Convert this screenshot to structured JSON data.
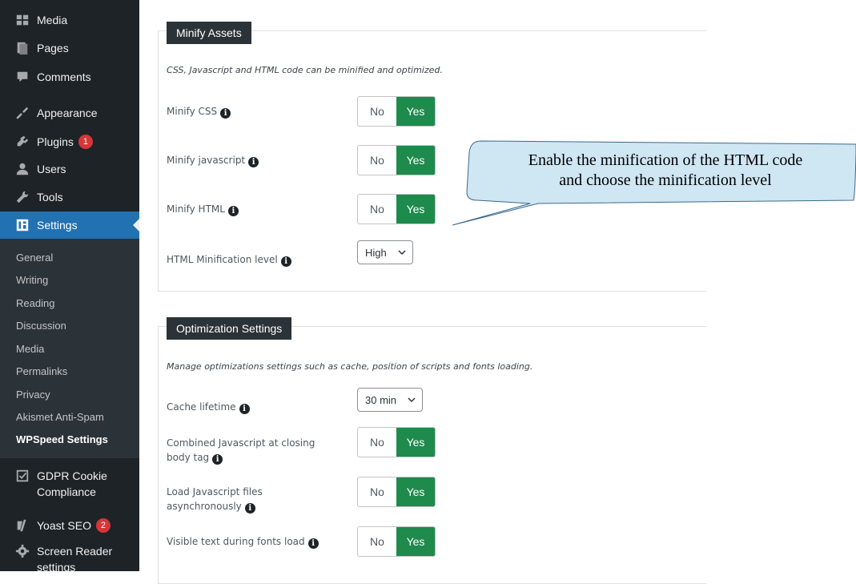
{
  "sidebar": {
    "menu": [
      {
        "label": "Media",
        "icon": "media-icon"
      },
      {
        "label": "Pages",
        "icon": "pages-icon"
      },
      {
        "label": "Comments",
        "icon": "comments-icon"
      },
      {
        "label": "Appearance",
        "icon": "appearance-icon"
      },
      {
        "label": "Plugins",
        "icon": "plugins-icon",
        "badge": "1"
      },
      {
        "label": "Users",
        "icon": "users-icon"
      },
      {
        "label": "Tools",
        "icon": "tools-icon"
      },
      {
        "label": "Settings",
        "icon": "settings-icon"
      }
    ],
    "submenu": [
      "General",
      "Writing",
      "Reading",
      "Discussion",
      "Media",
      "Permalinks",
      "Privacy",
      "Akismet Anti-Spam",
      "WPSpeed Settings"
    ],
    "bottom_menu": [
      {
        "label_line1": "GDPR Cookie",
        "label_line2": "Compliance",
        "icon": "checkbox-icon"
      },
      {
        "label": "Yoast SEO",
        "icon": "yoast-icon",
        "badge": "2"
      },
      {
        "label_line1": "Screen Reader",
        "label_line2": "settings",
        "icon": "gear-icon"
      }
    ]
  },
  "minify_panel": {
    "title": "Minify Assets",
    "description": "CSS, Javascript and HTML code can be minified and optimized.",
    "rows": [
      {
        "label": "Minify CSS",
        "no": "No",
        "yes": "Yes"
      },
      {
        "label": "Minify javascript",
        "no": "No",
        "yes": "Yes"
      },
      {
        "label": "Minify HTML",
        "no": "No",
        "yes": "Yes"
      }
    ],
    "level": {
      "label": "HTML Minification level",
      "value": "High"
    }
  },
  "optimization_panel": {
    "title": "Optimization Settings",
    "description": "Manage optimizations settings such as cache, position of scripts and fonts loading.",
    "cache": {
      "label": "Cache lifetime",
      "value": "30 min"
    },
    "rows": [
      {
        "label_line1": "Combined Javascript at closing",
        "label_line2": "body tag",
        "no": "No",
        "yes": "Yes"
      },
      {
        "label_line1": "Load Javascript files",
        "label_line2": "asynchronously",
        "no": "No",
        "yes": "Yes"
      },
      {
        "label": "Visible text during fonts load",
        "no": "No",
        "yes": "Yes"
      }
    ]
  },
  "callout": {
    "line1": "Enable the minification of the HTML code",
    "line2": "and choose the minification level"
  },
  "colors": {
    "sidebar_bg": "#1d2327",
    "active_bg": "#2271b1",
    "yes_green": "#1e8a4c",
    "badge_red": "#d63638",
    "callout_fill": "#cfe6f3"
  }
}
